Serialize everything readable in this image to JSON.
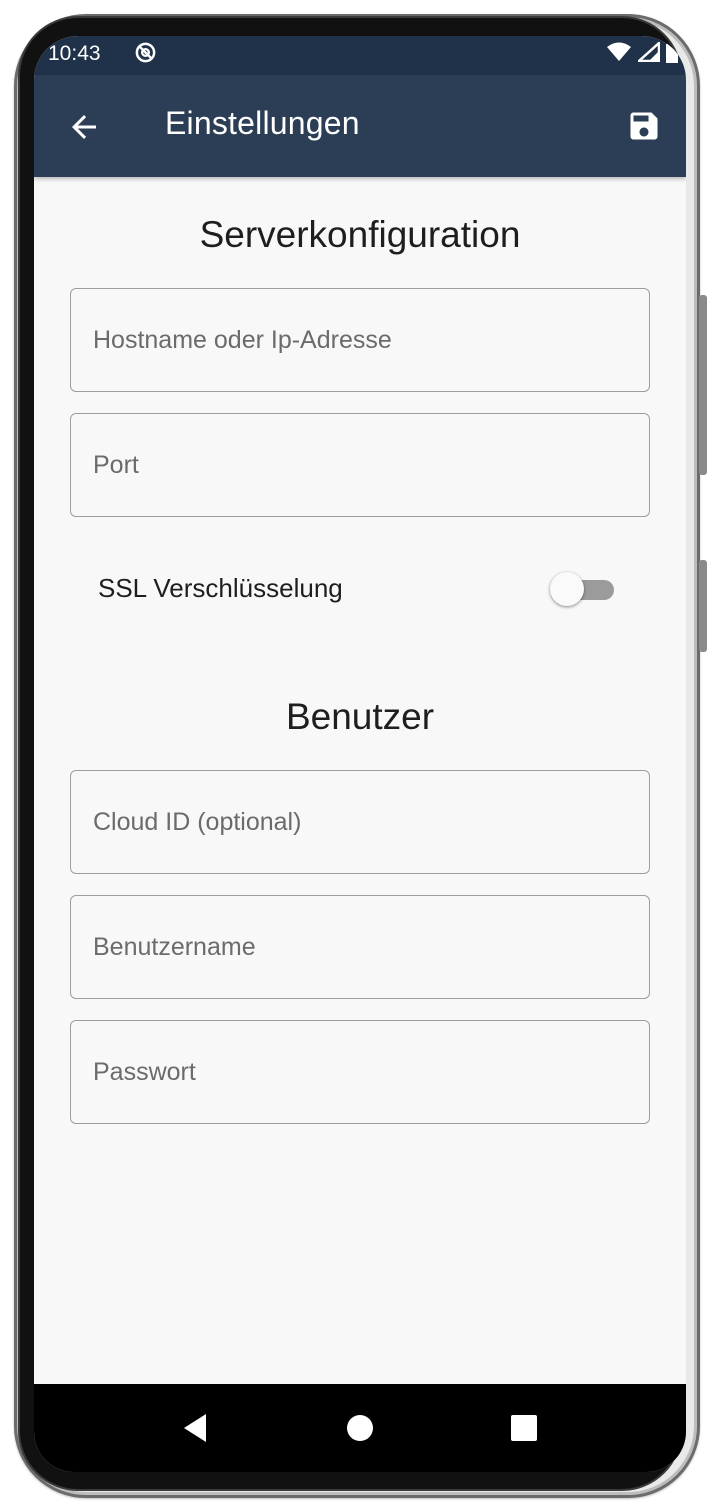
{
  "status_bar": {
    "time": "10:43",
    "icons": [
      "dnd-icon",
      "wifi-icon",
      "signal-icon",
      "battery-icon"
    ]
  },
  "app_bar": {
    "title": "Einstellungen",
    "back_icon": "arrow-left-icon",
    "save_icon": "floppy-disk-icon"
  },
  "server_section": {
    "title": "Serverkonfiguration",
    "host_placeholder": "Hostname oder Ip-Adresse",
    "host_value": "",
    "port_placeholder": "Port",
    "port_value": "",
    "ssl_label": "SSL Verschlüsselung",
    "ssl_enabled": false
  },
  "user_section": {
    "title": "Benutzer",
    "cloud_id_placeholder": "Cloud ID (optional)",
    "cloud_id_value": "",
    "username_placeholder": "Benutzername",
    "username_value": "",
    "password_placeholder": "Passwort",
    "password_value": ""
  },
  "nav_bar": {
    "icons": [
      "nav-back-icon",
      "nav-home-icon",
      "nav-recents-icon"
    ]
  },
  "colors": {
    "status_bar": "#1f3249",
    "app_bar": "#2c3e55",
    "background": "#f8f8f8",
    "switch_track": "#9b9b9b"
  }
}
